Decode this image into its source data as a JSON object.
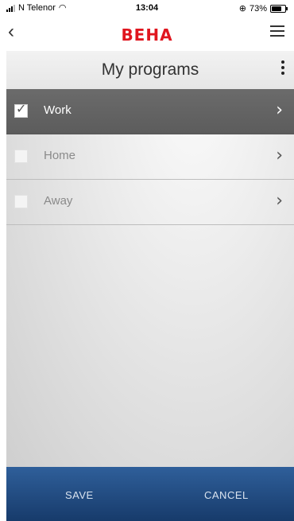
{
  "status_bar": {
    "carrier": "N Telenor",
    "time": "13:04",
    "battery": "73%",
    "battery_level": 0.73
  },
  "header": {
    "logo_text": "BEHA",
    "back_symbol": "‹"
  },
  "title_bar": {
    "title": "My programs"
  },
  "programs": [
    {
      "label": "Work",
      "checked": true
    },
    {
      "label": "Home",
      "checked": false
    },
    {
      "label": "Away",
      "checked": false
    }
  ],
  "footer": {
    "save_label": "SAVE",
    "cancel_label": "CANCEL"
  },
  "colors": {
    "brand_red": "#e0161f",
    "selected_row": "#616161",
    "footer_blue": "#234c82"
  }
}
